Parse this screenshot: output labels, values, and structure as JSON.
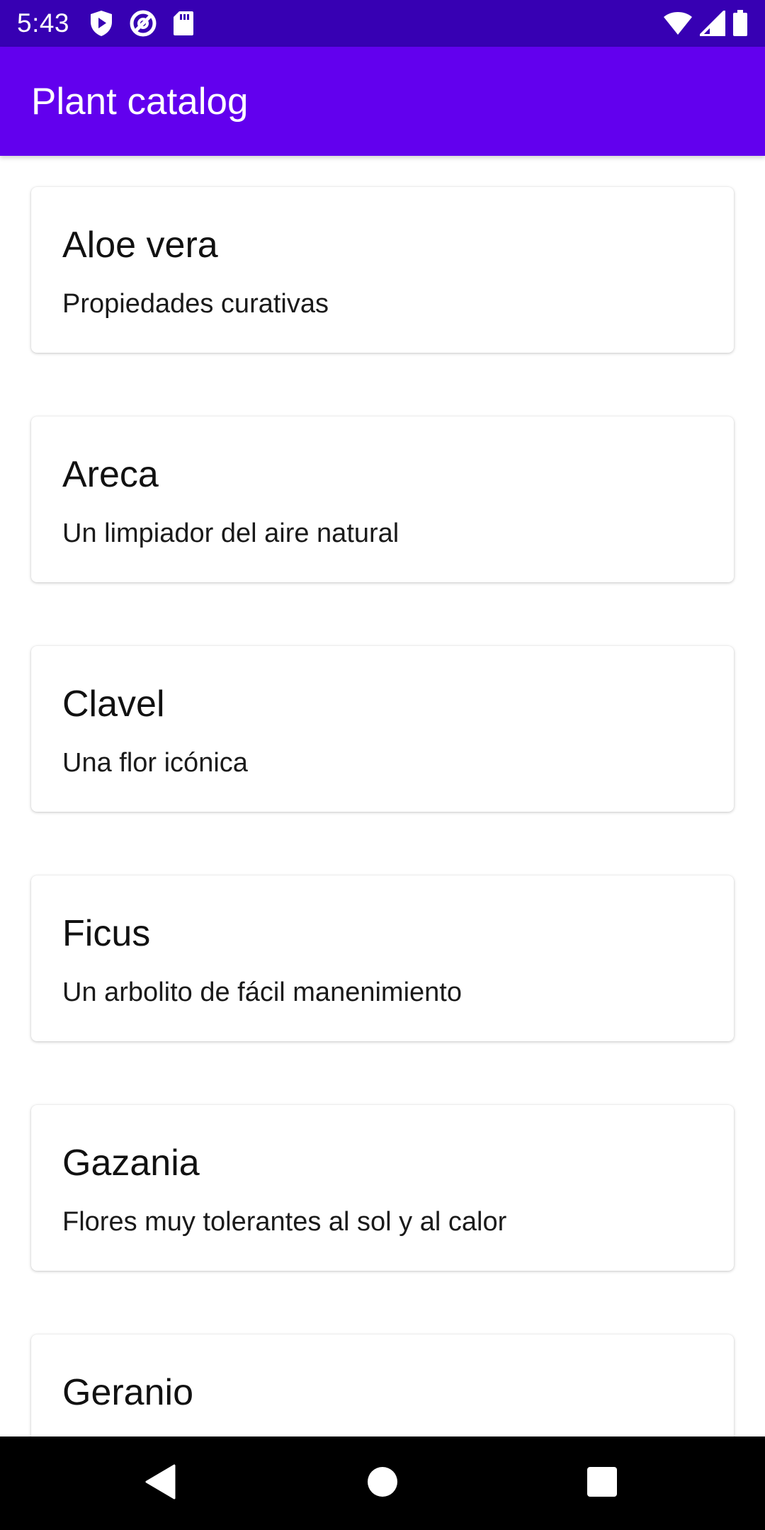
{
  "status_bar": {
    "time": "5:43",
    "left_icons": [
      "play-protect-icon",
      "at-sign-icon",
      "sd-card-icon"
    ],
    "right_icons": [
      "wifi-icon",
      "signal-icon",
      "battery-icon"
    ]
  },
  "app_bar": {
    "title": "Plant catalog"
  },
  "plants": [
    {
      "name": "Aloe vera",
      "description": "Propiedades curativas"
    },
    {
      "name": "Areca",
      "description": "Un limpiador del aire natural"
    },
    {
      "name": "Clavel",
      "description": "Una flor icónica"
    },
    {
      "name": "Ficus",
      "description": "Un arbolito de fácil manenimiento"
    },
    {
      "name": "Gazania",
      "description": "Flores muy tolerantes al sol y al calor"
    },
    {
      "name": "Geranio",
      "description": ""
    }
  ],
  "nav_bar": {
    "buttons": [
      "back-icon",
      "home-icon",
      "recents-icon"
    ]
  },
  "colors": {
    "status_bar": "#3700b3",
    "app_bar": "#6200ee",
    "nav_bar": "#000000"
  }
}
